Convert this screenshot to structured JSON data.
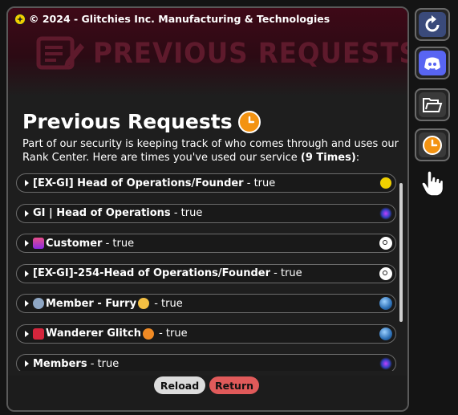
{
  "header": {
    "copyright": "© 2024 - Glitchies Inc. Manufacturing & Technologies",
    "banner_title": "PREVIOUS REQUESTS"
  },
  "main": {
    "title": "Previous Requests",
    "description_prefix": "Part of our security is keeping track of who comes through and uses our Rank Center. Here are times you've used our service ",
    "description_count": "(9 Times)",
    "description_suffix": ":"
  },
  "requests": [
    {
      "name": "[EX-GI] Head of Operations/Founder",
      "separator": " - ",
      "value": "true",
      "icon": "glitchies-logo-icon"
    },
    {
      "name": "GI | Head of Operations",
      "separator": " - ",
      "value": "true",
      "icon": "galaxy-icon"
    },
    {
      "name": "Customer",
      "separator": " - ",
      "value": "true",
      "icon": "target-icon"
    },
    {
      "name": "[EX-GI]-254-Head of Operations/Founder",
      "separator": " - ",
      "value": "true",
      "icon": "target-icon"
    },
    {
      "name": "Member - Furry",
      "separator": " - ",
      "value": "true",
      "icon": "globe-icon"
    },
    {
      "name": "Wanderer Glitch",
      "separator": " - ",
      "value": "true",
      "icon": "globe-icon"
    },
    {
      "name": "Members",
      "separator": " - ",
      "value": "true",
      "icon": "galaxy-icon"
    }
  ],
  "footer": {
    "reload_label": "Reload",
    "return_label": "Return"
  },
  "sidebar": {
    "items": [
      {
        "icon": "refresh-icon"
      },
      {
        "icon": "discord-icon"
      },
      {
        "icon": "folder-icon"
      },
      {
        "icon": "clock-icon"
      }
    ]
  },
  "colors": {
    "banner": "#3e0917",
    "return_button": "#e05a5a",
    "reload_button": "#dcdcdc",
    "clock_accent": "#f39312",
    "discord": "#5865f2"
  }
}
